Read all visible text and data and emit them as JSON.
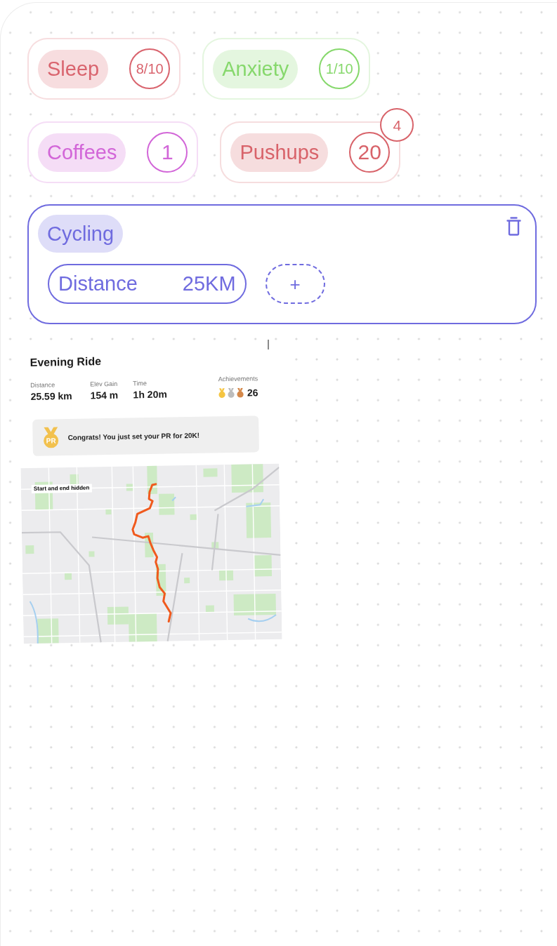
{
  "trackers": [
    {
      "label": "Sleep",
      "value": "8/10",
      "color": "#d9646e"
    },
    {
      "label": "Anxiety",
      "value": "1/10",
      "color": "#86d86c"
    },
    {
      "label": "Coffees",
      "value": "1",
      "color": "#d266d8"
    },
    {
      "label": "Pushups",
      "value": "20",
      "color": "#d8636a",
      "badge": "4"
    }
  ],
  "exercise": {
    "label": "Cycling",
    "color": "#6f6bdf",
    "metrics": [
      {
        "label": "Distance",
        "value": "25KM"
      }
    ],
    "add_button": "+"
  },
  "activity": {
    "title": "Evening Ride",
    "stats": [
      {
        "label": "Distance",
        "value": "25.59 km"
      },
      {
        "label": "Elev Gain",
        "value": "154 m"
      },
      {
        "label": "Time",
        "value": "1h 20m"
      }
    ],
    "achievements": {
      "label": "Achievements",
      "medals": [
        {
          "color": "#f5c542"
        },
        {
          "color": "#bdbdbd"
        },
        {
          "color": "#d4884a"
        }
      ],
      "count": "26"
    },
    "pr_banner": {
      "icon_text": "PR",
      "text": "Congrats! You just set your PR for 20K!"
    },
    "map": {
      "overlay_label": "Start and end hidden"
    }
  }
}
